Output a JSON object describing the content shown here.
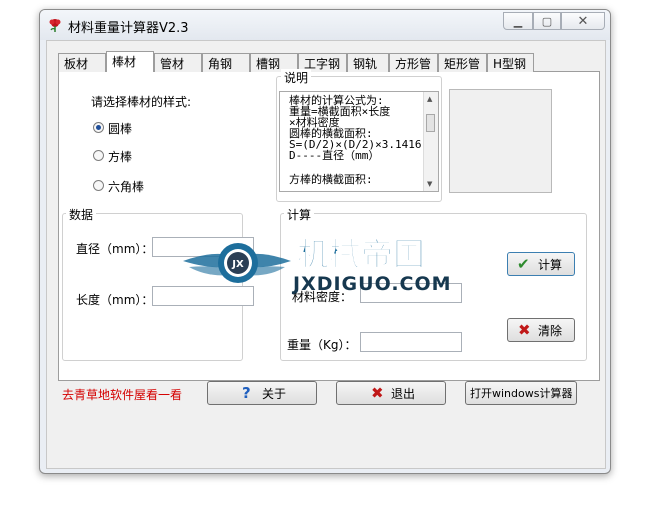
{
  "window": {
    "title": "材料重量计算器V2.3"
  },
  "tabs": [
    {
      "label": "板材",
      "active": false
    },
    {
      "label": "棒材",
      "active": true
    },
    {
      "label": "管材",
      "active": false
    },
    {
      "label": "角钢",
      "active": false
    },
    {
      "label": "槽钢",
      "active": false
    },
    {
      "label": "工字钢",
      "active": false
    },
    {
      "label": "钢轨",
      "active": false
    },
    {
      "label": "方形管",
      "active": false
    },
    {
      "label": "矩形管",
      "active": false
    },
    {
      "label": "H型钢",
      "active": false
    }
  ],
  "shape_select": {
    "prompt": "请选择棒材的样式:",
    "options": [
      {
        "label": "圆棒",
        "checked": true
      },
      {
        "label": "方棒",
        "checked": false
      },
      {
        "label": "六角棒",
        "checked": false
      }
    ]
  },
  "explanation": {
    "title": "说明",
    "lines": [
      "棒材的计算公式为:",
      "重量=横截面积×长度",
      "      ×材料密度",
      "圆棒的横截面积:",
      "S=(D/2)×(D/2)×3.1416",
      "D----直径（mm）",
      "",
      "方棒的横截面积:"
    ]
  },
  "data_group": {
    "title": "数据",
    "diameter_label": "直径（mm）：",
    "length_label": "长度（mm）：",
    "diameter_value": "",
    "length_value": ""
  },
  "calc_group": {
    "title": "计算",
    "density_label": "材料密度：",
    "weight_label": "重量（Kg）：",
    "density_value": "",
    "weight_value": "",
    "calculate_label": "计算",
    "clear_label": "清除"
  },
  "watermark": {
    "text": "机械帝国",
    "domain": "JXDIGUO.COM",
    "badge": "JX"
  },
  "footer": {
    "link": "去青草地软件屋看一看",
    "about_label": "关于",
    "exit_label": "退出",
    "calculator_label": "打开windows计算器"
  },
  "colors": {
    "link_red": "#d40000",
    "check_green": "#2e8b2e",
    "close_red": "#c01818",
    "help_blue": "#1f5fbf",
    "watermark_blue": "#1d6e9c"
  }
}
